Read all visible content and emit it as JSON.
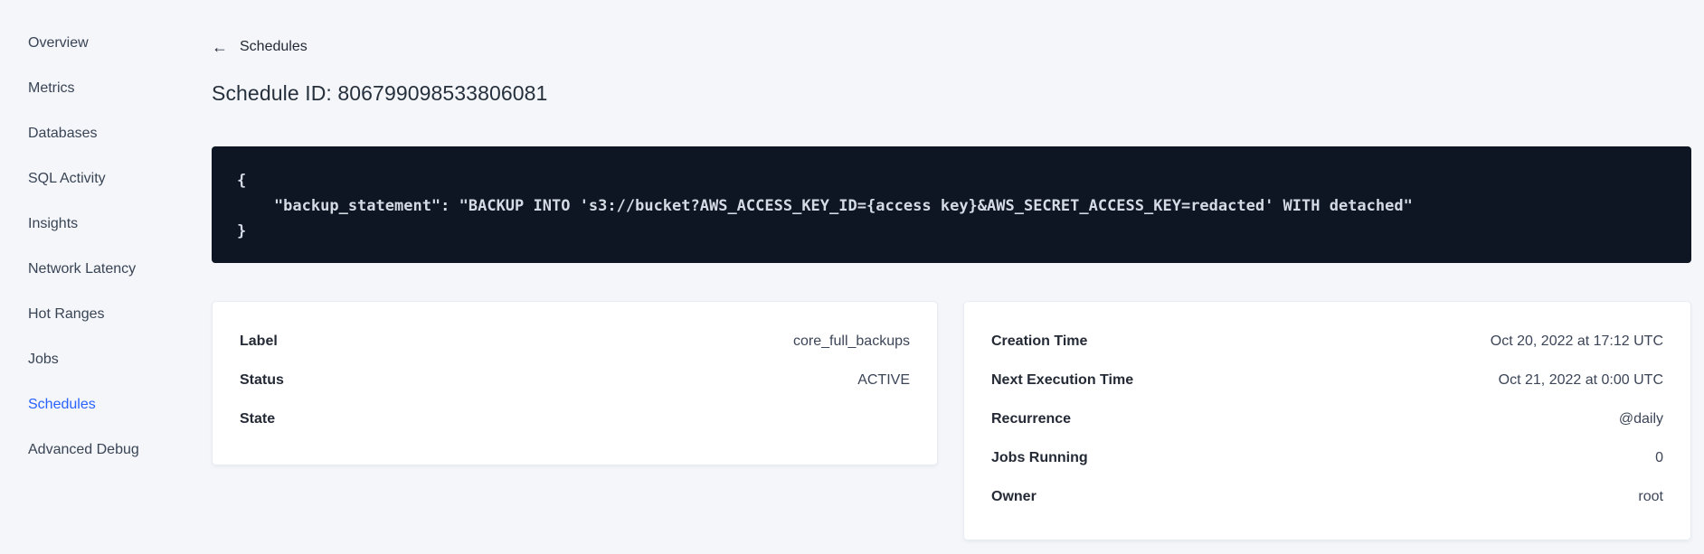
{
  "colors": {
    "page_background": "#f4f6fa",
    "accent_blue": "#2962ff",
    "code_background": "#0e1624",
    "code_text": "#d5dbe5",
    "card_background": "#ffffff",
    "text_primary": "#242a35"
  },
  "icons": {
    "arrow_left": "←"
  },
  "sidebar": {
    "items": [
      {
        "label": "Overview",
        "active": false
      },
      {
        "label": "Metrics",
        "active": false
      },
      {
        "label": "Databases",
        "active": false
      },
      {
        "label": "SQL Activity",
        "active": false
      },
      {
        "label": "Insights",
        "active": false
      },
      {
        "label": "Network Latency",
        "active": false
      },
      {
        "label": "Hot Ranges",
        "active": false
      },
      {
        "label": "Jobs",
        "active": false
      },
      {
        "label": "Schedules",
        "active": true
      },
      {
        "label": "Advanced Debug",
        "active": false
      }
    ]
  },
  "header": {
    "back_link_label": "Schedules",
    "page_title": "Schedule ID: 806799098533806081"
  },
  "code": {
    "lines": [
      "{",
      "    \"backup_statement\": \"BACKUP INTO 's3://bucket?AWS_ACCESS_KEY_ID={access key}&AWS_SECRET_ACCESS_KEY=redacted' WITH detached\"",
      "}"
    ]
  },
  "cards": {
    "details": {
      "rows": [
        {
          "label": "Label",
          "value": "core_full_backups"
        },
        {
          "label": "Status",
          "value": "ACTIVE"
        },
        {
          "label": "State",
          "value": ""
        }
      ]
    },
    "schedule": {
      "rows": [
        {
          "label": "Creation Time",
          "value": "Oct 20, 2022 at 17:12 UTC"
        },
        {
          "label": "Next Execution Time",
          "value": "Oct 21, 2022 at 0:00 UTC"
        },
        {
          "label": "Recurrence",
          "value": "@daily"
        },
        {
          "label": "Jobs Running",
          "value": "0"
        },
        {
          "label": "Owner",
          "value": "root"
        }
      ]
    }
  }
}
